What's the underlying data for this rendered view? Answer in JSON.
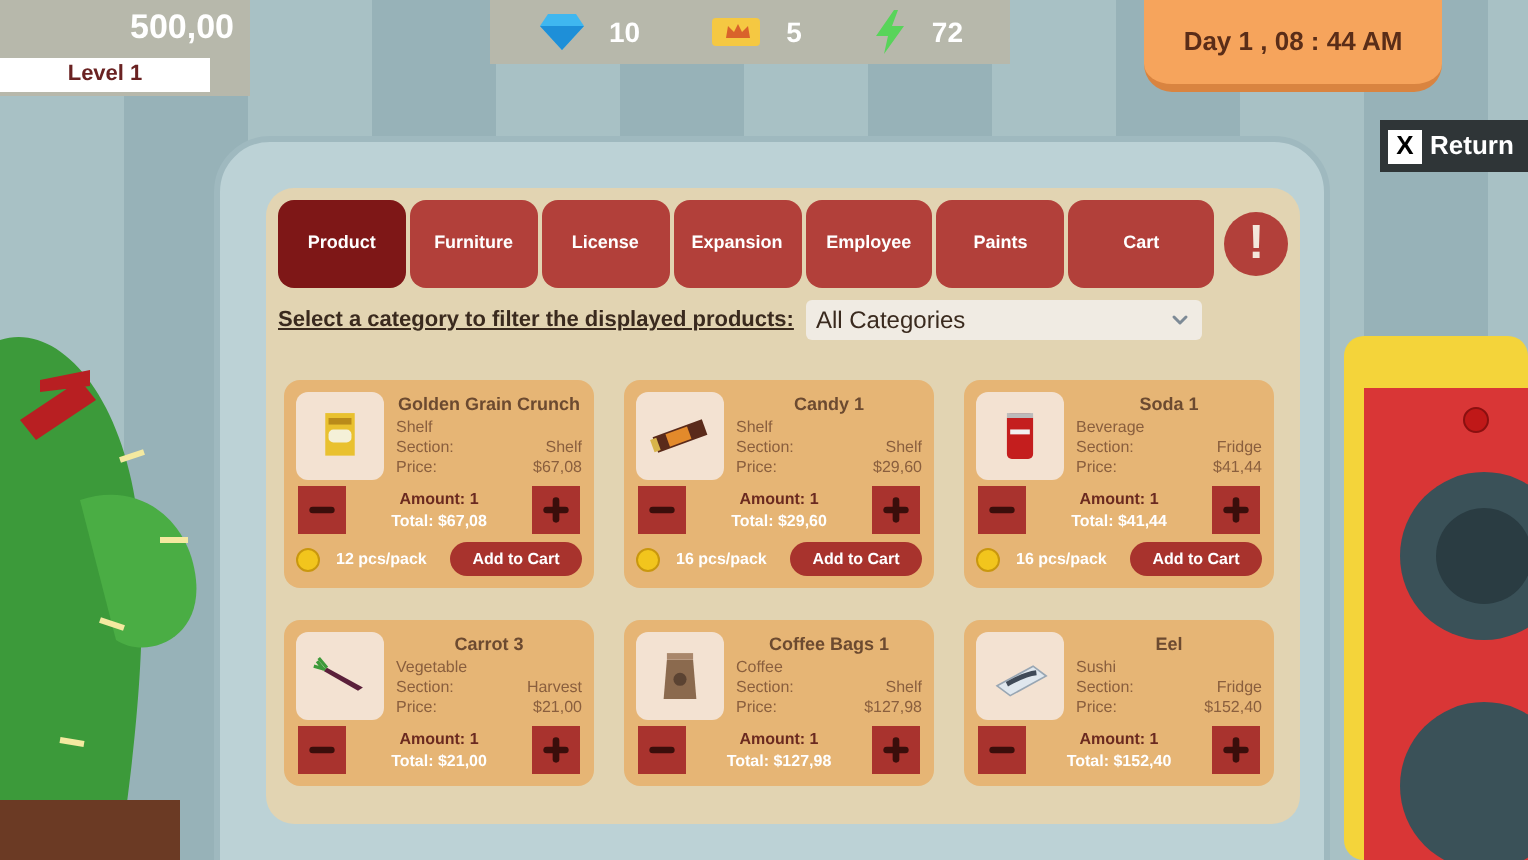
{
  "hud": {
    "money": "500,00",
    "level": "Level 1",
    "resources": [
      {
        "kind": "gem",
        "value": "10"
      },
      {
        "kind": "ticket",
        "value": "5"
      },
      {
        "kind": "energy",
        "value": "72"
      }
    ],
    "clock": "Day 1 , 08 : 44 AM"
  },
  "return_button": {
    "key": "X",
    "label": "Return"
  },
  "tabs": [
    {
      "label": "Product",
      "selected": true
    },
    {
      "label": "Furniture",
      "selected": false
    },
    {
      "label": "License",
      "selected": false
    },
    {
      "label": "Expansion",
      "selected": false
    },
    {
      "label": "Employee",
      "selected": false
    },
    {
      "label": "Paints",
      "selected": false
    },
    {
      "label": "Cart",
      "selected": false
    }
  ],
  "alert": "!",
  "filter": {
    "label": "Select a category to filter the displayed products:",
    "value": "All Categories"
  },
  "products": [
    {
      "kind": "cereal",
      "name": "Golden Grain Crunch",
      "category": "Shelf",
      "section_label": "Section:",
      "section": "Shelf",
      "price_label": "Price:",
      "price": "$67,08",
      "amount": "Amount: 1",
      "total": "Total: $67,08",
      "pack": "12 pcs/pack",
      "add": "Add to Cart"
    },
    {
      "kind": "candy",
      "name": "Candy 1",
      "category": "Shelf",
      "section_label": "Section:",
      "section": "Shelf",
      "price_label": "Price:",
      "price": "$29,60",
      "amount": "Amount: 1",
      "total": "Total: $29,60",
      "pack": "16 pcs/pack",
      "add": "Add to Cart"
    },
    {
      "kind": "soda",
      "name": "Soda 1",
      "category": "Beverage",
      "section_label": "Section:",
      "section": "Fridge",
      "price_label": "Price:",
      "price": "$41,44",
      "amount": "Amount: 1",
      "total": "Total: $41,44",
      "pack": "16 pcs/pack",
      "add": "Add to Cart"
    },
    {
      "kind": "carrot",
      "name": "Carrot 3",
      "category": "Vegetable",
      "section_label": "Section:",
      "section": "Harvest",
      "price_label": "Price:",
      "price": "$21,00",
      "amount": "Amount: 1",
      "total": "Total: $21,00"
    },
    {
      "kind": "coffee",
      "name": "Coffee Bags 1",
      "category": "Coffee",
      "section_label": "Section:",
      "section": "Shelf",
      "price_label": "Price:",
      "price": "$127,98",
      "amount": "Amount: 1",
      "total": "Total: $127,98"
    },
    {
      "kind": "eel",
      "name": "Eel",
      "category": "Sushi",
      "section_label": "Section:",
      "section": "Fridge",
      "price_label": "Price:",
      "price": "$152,40",
      "amount": "Amount: 1",
      "total": "Total: $152,40"
    }
  ]
}
